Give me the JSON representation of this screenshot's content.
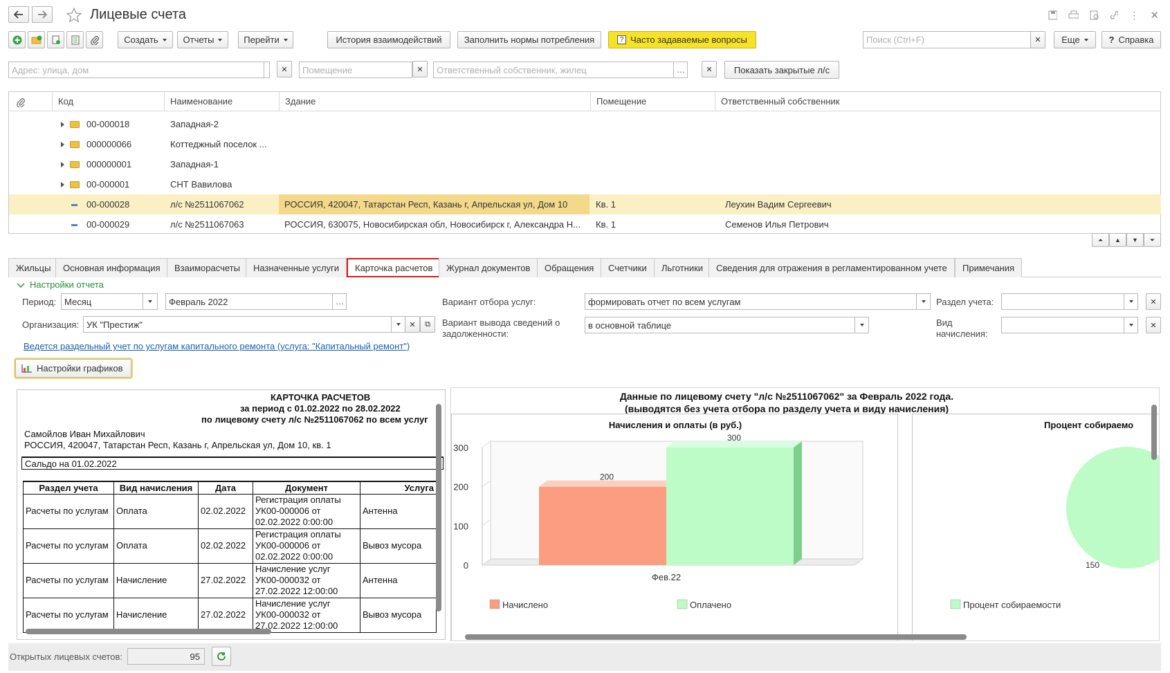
{
  "window": {
    "title": "Лицевые счета"
  },
  "toolbar": {
    "create": "Создать",
    "reports": "Отчеты",
    "goto": "Перейти",
    "history": "История взаимодействий",
    "fill_norms": "Заполнить нормы потребления",
    "faq": "Часто задаваемые вопросы",
    "search_placeholder": "Поиск (Ctrl+F)",
    "more": "Еще",
    "help": "Справка"
  },
  "filters": {
    "address_placeholder": "Адрес: улица, дом",
    "room_placeholder": "Помещение",
    "owner_placeholder": "Ответственный собственник, жилец",
    "show_closed": "Показать закрытые л/с"
  },
  "grid": {
    "columns": [
      "Код",
      "Наименование",
      "Здание",
      "Помещение",
      "Ответственный собственник"
    ],
    "rows": [
      {
        "code": "00-000018",
        "name": "Западная-2",
        "building": "",
        "room": "",
        "owner": "",
        "kind": "folder"
      },
      {
        "code": "000000066",
        "name": "Коттеджный поселок ...",
        "building": "",
        "room": "",
        "owner": "",
        "kind": "folder"
      },
      {
        "code": "000000001",
        "name": "Западная-1",
        "building": "",
        "room": "",
        "owner": "",
        "kind": "folder"
      },
      {
        "code": "00-000001",
        "name": "СНТ Вавилова",
        "building": "",
        "room": "",
        "owner": "",
        "kind": "folder"
      },
      {
        "code": "00-000028",
        "name": "л/с №2511067062",
        "building": "РОССИЯ, 420047, Татарстан Респ, Казань г, Апрельская ул, Дом 10",
        "room": "Кв. 1",
        "owner": "Леухин Вадим Сергеевич",
        "kind": "item"
      },
      {
        "code": "00-000029",
        "name": "л/с №2511067063",
        "building": "РОССИЯ, 630075, Новосибирская обл, Новосибирск г, Александра Н...",
        "room": "Кв. 1",
        "owner": "Семенов Илья Петрович",
        "kind": "item"
      }
    ]
  },
  "tabs": [
    "Жильцы",
    "Основная информация",
    "Взаиморасчеты",
    "Назначенные услуги",
    "Карточка расчетов",
    "Журнал документов",
    "Обращения",
    "Счетчики",
    "Льготники",
    "Сведения для отражения в регламентированном учете",
    "Примечания"
  ],
  "settings": {
    "header": "Настройки отчета",
    "period_label": "Период:",
    "period_value": "Месяц",
    "month_value": "Февраль 2022",
    "org_label": "Организация:",
    "org_value": "УК \"Престиж\"",
    "variant_label": "Вариант отбора услуг:",
    "variant_value": "формировать отчет по всем услугам",
    "debt_label": "Вариант вывода сведений о задолженности:",
    "debt_value": "в основной таблице",
    "section_label": "Раздел учета:",
    "kind_label": "Вид начисления:",
    "capital_link": "Ведется раздельный учет по услугам капитального ремонта (услуга: \"Капитальный ремонт\")",
    "chart_settings": "Настройки графиков"
  },
  "report": {
    "title": "КАРТОЧКА РАСЧЕТОВ",
    "period": "за период с 01.02.2022 по 28.02.2022",
    "account": "по лицевому счету л/с №2511067062 по всем услуг",
    "person": "Самойлов Иван Михайлович",
    "address": "РОССИЯ, 420047, Татарстан Респ, Казань г, Апрельская ул, Дом 10, кв. 1",
    "saldo": "Сальдо на 01.02.2022",
    "columns": [
      "Раздел учета",
      "Вид начисления",
      "Дата",
      "Документ",
      "Услуга"
    ],
    "rows": [
      {
        "section": "Расчеты по услугам",
        "kind": "Оплата",
        "date": "02.02.2022",
        "doc1": "Регистрация оплаты",
        "doc2": "УК00-000006 от",
        "doc3": "02.02.2022 0:00:00",
        "service": "Антенна"
      },
      {
        "section": "Расчеты по услугам",
        "kind": "Оплата",
        "date": "02.02.2022",
        "doc1": "Регистрация оплаты",
        "doc2": "УК00-000006 от",
        "doc3": "02.02.2022 0:00:00",
        "service": "Вывоз мусора"
      },
      {
        "section": "Расчеты по услугам",
        "kind": "Начисление",
        "date": "27.02.2022",
        "doc1": "Начисление услуг",
        "doc2": "УК00-000032 от",
        "doc3": "27.02.2022 12:00:00",
        "service": "Антенна"
      },
      {
        "section": "Расчеты по услугам",
        "kind": "Начисление",
        "date": "27.02.2022",
        "doc1": "Начисление услуг",
        "doc2": "УК00-000032 от",
        "doc3": "27.02.2022 12:00:00",
        "service": "Вывоз мусора"
      }
    ]
  },
  "charts_header": {
    "line1": "Данные по лицевому счету \"л/с №2511067062\" за Февраль 2022 года.",
    "line2": "(выводятся без учета отбора по разделу учета и виду начисления)"
  },
  "chart_data": [
    {
      "type": "bar",
      "title": "Начисления и оплаты (в руб.)",
      "categories": [
        "Фев.22"
      ],
      "series": [
        {
          "name": "Начислено",
          "values": [
            200
          ],
          "color": "#fa9d80"
        },
        {
          "name": "Оплачено",
          "values": [
            300
          ],
          "color": "#bdfcc6"
        }
      ],
      "yticks": [
        0,
        100,
        200,
        300
      ],
      "ylim": [
        0,
        300
      ]
    },
    {
      "type": "pie",
      "title": "Процент собираемо",
      "series": [
        {
          "name": "Процент собираемости",
          "values": [
            150
          ],
          "color": "#bdfcc6"
        }
      ]
    }
  ],
  "footer": {
    "open_accounts_label": "Открытых лицевых счетов:",
    "open_accounts_value": "95"
  },
  "colors": {
    "accent_tab_border": "#e0161b",
    "faq_bg": "#f7e22a",
    "selected_row": "#fbf0c4",
    "link": "#1a5fb4"
  }
}
